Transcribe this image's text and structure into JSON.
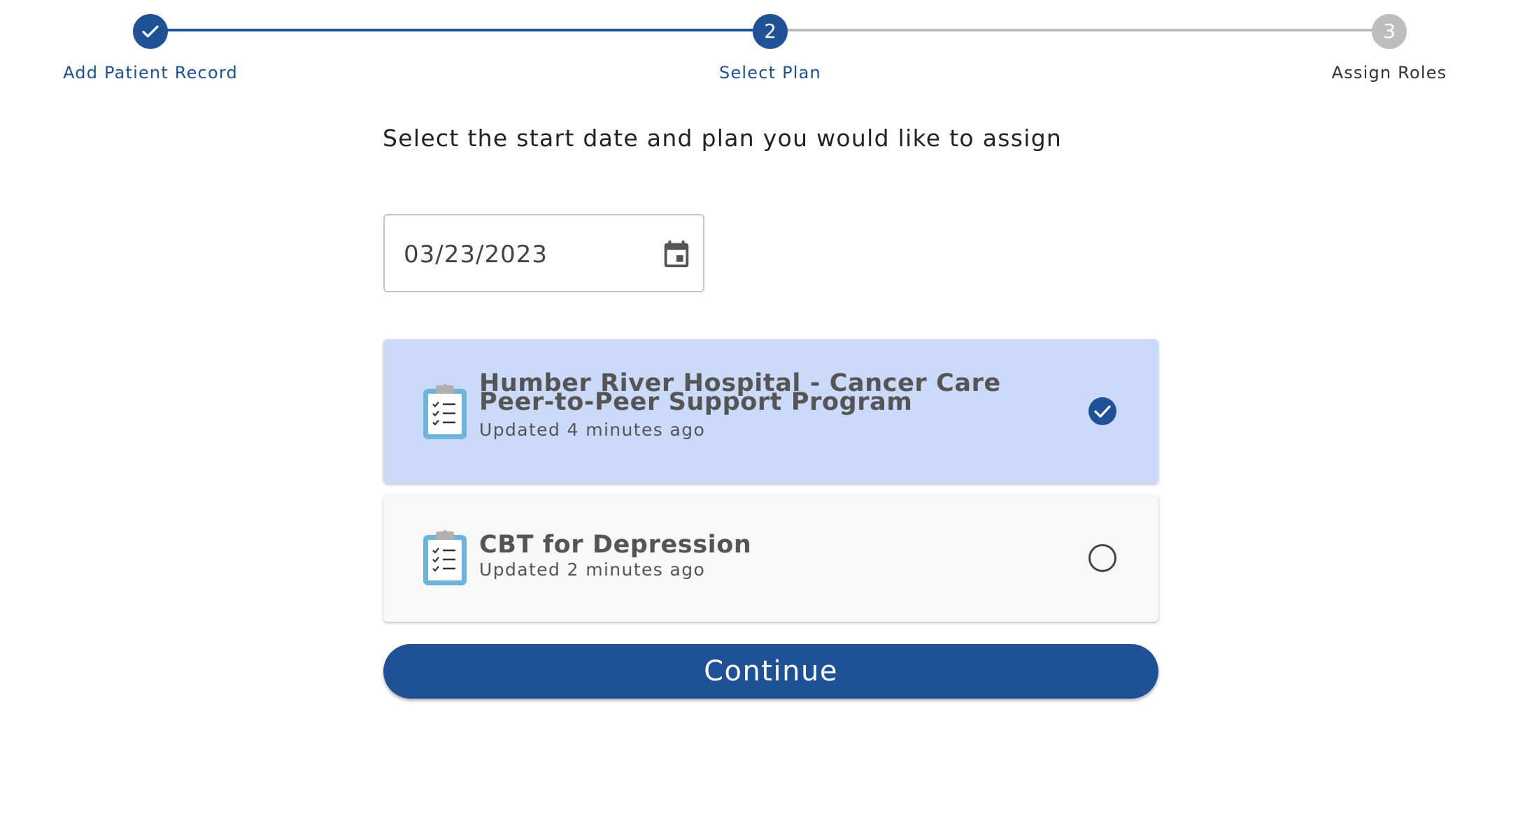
{
  "stepper": {
    "steps": [
      {
        "label": "Add Patient Record",
        "number": "1",
        "state": "completed"
      },
      {
        "label": "Select Plan",
        "number": "2",
        "state": "active"
      },
      {
        "label": "Assign Roles",
        "number": "3",
        "state": "pending"
      }
    ]
  },
  "form": {
    "instruction": "Select the start date and plan you would like to assign",
    "start_date": "03/23/2023",
    "calendar_icon": "calendar-icon"
  },
  "plans": [
    {
      "title": "Humber River Hospital - Cancer Care Peer-to-Peer Support Program",
      "updated": "Updated 4 minutes ago",
      "selected": true
    },
    {
      "title": "CBT for Depression",
      "updated": "Updated 2 minutes ago",
      "selected": false
    }
  ],
  "actions": {
    "continue_label": "Continue"
  },
  "colors": {
    "primary": "#1f5196",
    "selected_card": "#cbdaf8",
    "inactive_step": "#bdbdbd",
    "clipboard": "#6db3e0"
  }
}
